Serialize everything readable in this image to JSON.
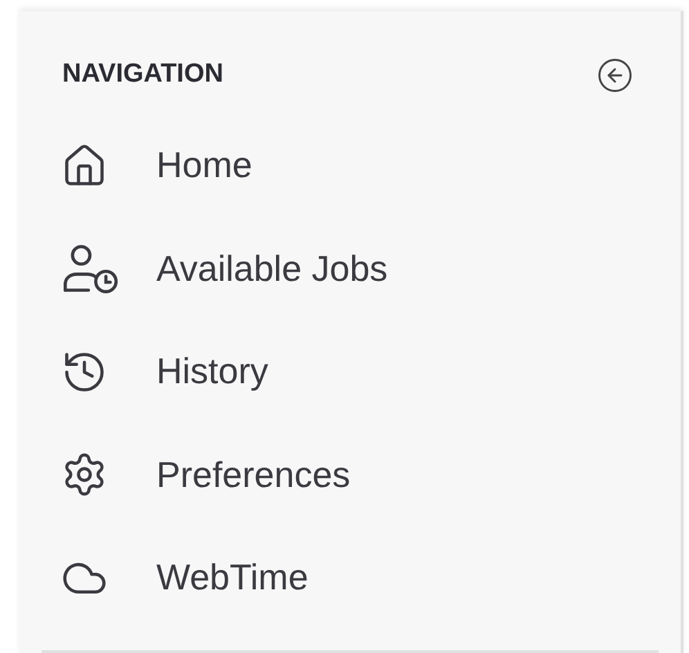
{
  "navigation": {
    "title": "NAVIGATION",
    "items": [
      {
        "label": "Home"
      },
      {
        "label": "Available Jobs"
      },
      {
        "label": "History"
      },
      {
        "label": "Preferences"
      },
      {
        "label": "WebTime"
      }
    ]
  }
}
